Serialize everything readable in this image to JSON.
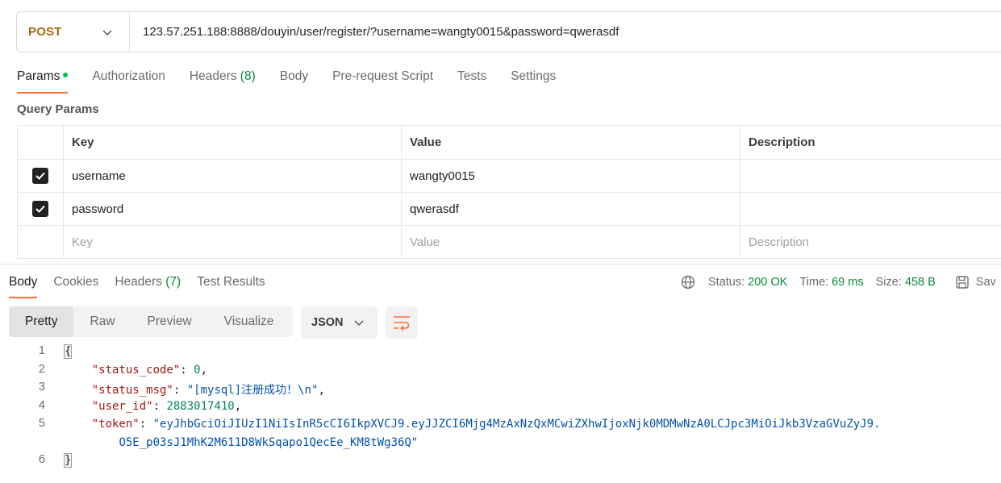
{
  "request": {
    "method": "POST",
    "url": "123.57.251.188:8888/douyin/user/register/?username=wangty0015&password=qwerasdf"
  },
  "request_tabs": [
    {
      "label": "Params"
    },
    {
      "label": "Authorization"
    },
    {
      "label": "Headers",
      "count": "(8)"
    },
    {
      "label": "Body"
    },
    {
      "label": "Pre-request Script"
    },
    {
      "label": "Tests"
    },
    {
      "label": "Settings"
    }
  ],
  "query_params": {
    "title": "Query Params",
    "headers": {
      "key": "Key",
      "value": "Value",
      "description": "Description"
    },
    "rows": [
      {
        "checked": true,
        "key": "username",
        "value": "wangty0015",
        "description": ""
      },
      {
        "checked": true,
        "key": "password",
        "value": "qwerasdf",
        "description": ""
      }
    ],
    "placeholder": {
      "key": "Key",
      "value": "Value",
      "description": "Description"
    }
  },
  "response_tabs": [
    {
      "label": "Body"
    },
    {
      "label": "Cookies"
    },
    {
      "label": "Headers",
      "count": "(7)"
    },
    {
      "label": "Test Results"
    }
  ],
  "response_status": {
    "status_label": "Status:",
    "status_value": "200 OK",
    "time_label": "Time:",
    "time_value": "69 ms",
    "size_label": "Size:",
    "size_value": "458 B",
    "save_label": "Sav"
  },
  "view_modes": [
    "Pretty",
    "Raw",
    "Preview",
    "Visualize"
  ],
  "format": "JSON",
  "code": {
    "line_numbers": [
      "1",
      "2",
      "3",
      "4",
      "5",
      "6"
    ],
    "open_brace": "{",
    "close_brace": "}",
    "status_code_key": "\"status_code\"",
    "status_code_value": "0",
    "status_msg_key": "\"status_msg\"",
    "status_msg_value": "\"[mysql]注册成功！\\n\"",
    "user_id_key": "\"user_id\"",
    "user_id_value": "2883017410",
    "token_key": "\"token\"",
    "token_value_line1": "\"eyJhbGciOiJIUzI1NiIsInR5cCI6IkpXVCJ9.eyJJZCI6Mjg4MzAxNzQxMCwiZXhwIjoxNjk0MDMwNzA0LCJpc3MiOiJkb3VzaGVuZyJ9.",
    "token_value_line2": "O5E_p03sJ1MhK2M611D8WkSqapo1QecEe_KM8tWg36Q\""
  },
  "colors": {
    "accent": "#ff6c37",
    "method": "#a36a0e",
    "success": "#0b8a3a"
  }
}
